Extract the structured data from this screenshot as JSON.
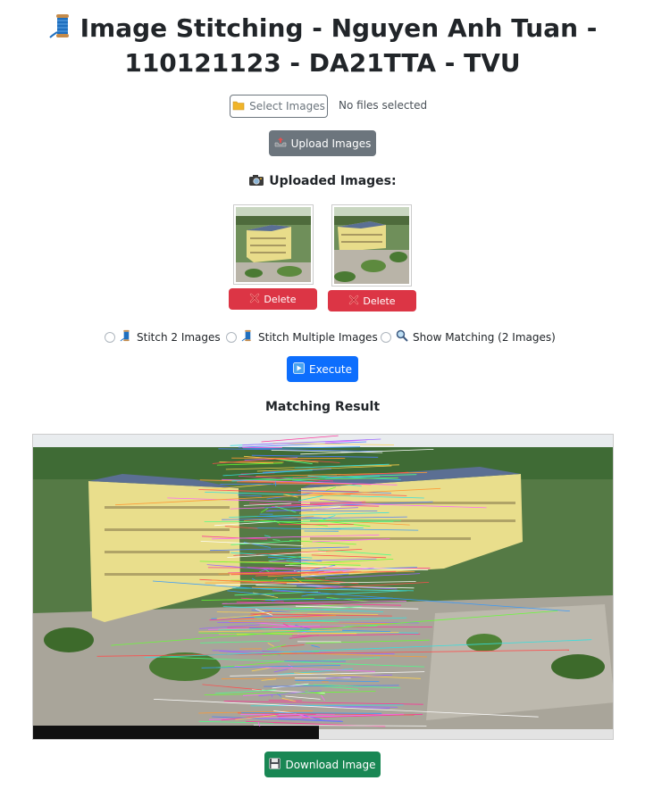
{
  "header": {
    "title": "Image Stitching - Nguyen Anh Tuan - 110121123 - DA21TTA - TVU",
    "icon": "thread-spool-icon"
  },
  "file_input": {
    "button_label": "Select Images",
    "status": "No files selected",
    "icon": "folder-icon"
  },
  "upload": {
    "label": "Upload Images",
    "icon": "outbox-tray-icon"
  },
  "uploaded": {
    "title": "Uploaded Images:",
    "icon": "camera-icon",
    "items": [
      {
        "delete_label": "Delete"
      },
      {
        "delete_label": "Delete"
      }
    ]
  },
  "modes": [
    {
      "label": "Stitch 2 Images",
      "icon": "thread-spool-icon",
      "selected": false
    },
    {
      "label": "Stitch Multiple Images",
      "icon": "thread-spool-icon",
      "selected": false
    },
    {
      "label": "Show Matching (2 Images)",
      "icon": "magnifier-icon",
      "selected": false
    }
  ],
  "execute": {
    "label": "Execute",
    "icon": "play-icon"
  },
  "result": {
    "title": "Matching Result"
  },
  "download": {
    "label": "Download Image",
    "icon": "floppy-disk-icon"
  },
  "colors": {
    "primary": "#0d6efd",
    "secondary": "#6c757d",
    "danger": "#dc3545",
    "success": "#198754"
  }
}
